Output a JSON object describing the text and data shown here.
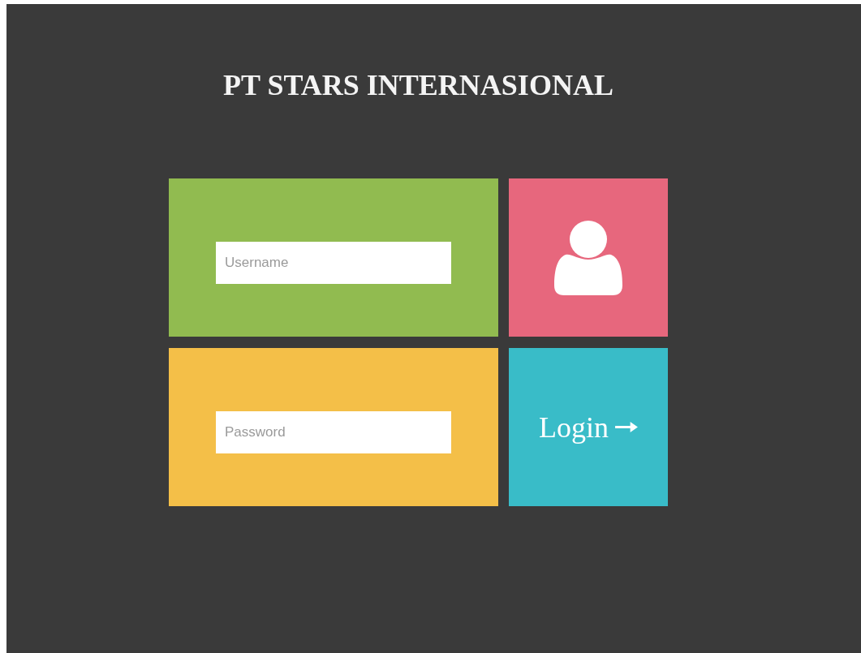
{
  "title": "PT STARS INTERNASIONAL",
  "fields": [
    {
      "placeholder": "Username"
    },
    {
      "placeholder": "Password"
    }
  ],
  "login_button": {
    "label": "Login"
  }
}
